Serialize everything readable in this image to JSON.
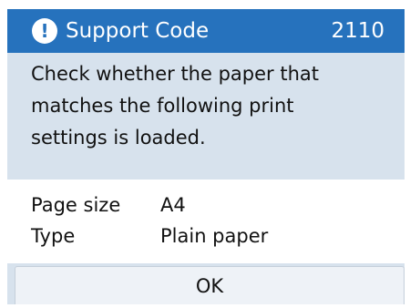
{
  "dialog": {
    "title": "Support Code",
    "code": "2110",
    "icon": "exclamation-circle-icon",
    "message_lines": [
      "Check whether the paper that",
      "matches the following print",
      "settings is loaded."
    ],
    "settings": [
      {
        "label": "Page size",
        "value": "A4"
      },
      {
        "label": "Type",
        "value": "Plain paper"
      }
    ],
    "ok_label": "OK"
  },
  "colors": {
    "title_bar": "#2672bd",
    "panel_background": "#d7e2ed",
    "settings_background": "#ffffff"
  }
}
